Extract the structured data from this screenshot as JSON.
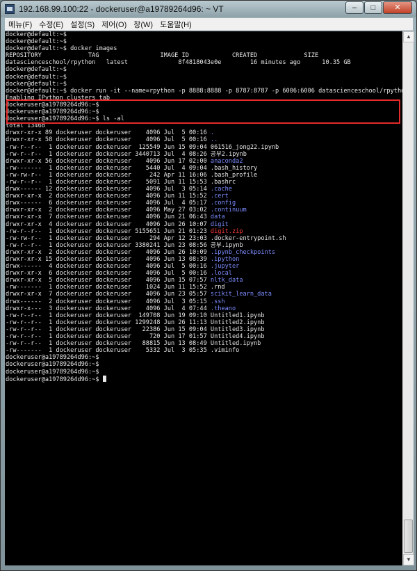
{
  "window": {
    "title": "192.168.99.100:22 - dockeruser@a19789264d96: ~ VT",
    "buttons": {
      "minimize": "–",
      "maximize": "□",
      "close": "✕"
    }
  },
  "menubar": {
    "items": [
      "메뉴(F)",
      "수정(E)",
      "설정(S)",
      "제어(O)",
      "창(W)",
      "도움말(H)"
    ]
  },
  "colors": {
    "terminal_bg": "#000000",
    "text": "#e8e8e8",
    "dir": "#7c8cff",
    "archive": "#ff3a3a",
    "highlight": "#e42a2a"
  },
  "terminal": {
    "lines": [
      [
        {
          "t": "docker@default:~$"
        }
      ],
      [
        {
          "t": "docker@default:~$"
        }
      ],
      [
        {
          "t": "docker@default:~$ docker images"
        }
      ],
      [
        {
          "t": "REPOSITORY             TAG                 IMAGE ID            CREATED             SIZE"
        }
      ],
      [
        {
          "t": "datascienceschool/rpython   latest              8f4818043e0e        16 minutes ago      10.35 GB"
        }
      ],
      [
        {
          "t": "docker@default:~$"
        }
      ],
      [
        {
          "t": "docker@default:~$"
        }
      ],
      [
        {
          "t": "docker@default:~$"
        }
      ],
      [
        {
          "t": "docker@default:~$ docker run -it --name=rpython -p 8888:8888 -p 8787:8787 -p 6006:6006 datascienceschool/rpython"
        }
      ],
      [
        {
          "t": "Enabling IPython clusters tab"
        }
      ],
      [
        {
          "t": "dockeruser@a19789264d96:~$"
        }
      ],
      [
        {
          "t": "dockeruser@a19789264d96:~$"
        }
      ],
      [
        {
          "t": "dockeruser@a19789264d96:~$ ls -al"
        }
      ],
      [
        {
          "t": "total 13468"
        }
      ],
      [
        {
          "t": "drwxr-xr-x 89 dockeruser dockeruser    4096 Jul  5 00:16 "
        },
        {
          "t": ".",
          "c": "dir"
        }
      ],
      [
        {
          "t": "drwxr-xr-x 58 dockeruser dockeruser    4096 Jul  5 00:16 "
        },
        {
          "t": "..",
          "c": "dir"
        }
      ],
      [
        {
          "t": "-rw-r--r--  1 dockeruser dockeruser  125549 Jun 15 09:04 061516_jong22.ipynb"
        }
      ],
      [
        {
          "t": "-rw-r--r--  1 dockeruser dockeruser 3440713 Jul  4 08:26 공부2.ipynb"
        }
      ],
      [
        {
          "t": "drwxr-xr-x 56 dockeruser dockeruser    4096 Jun 17 02:00 "
        },
        {
          "t": "anaconda2",
          "c": "dir"
        }
      ],
      [
        {
          "t": "-rw-------  1 dockeruser dockeruser    5440 Jul  4 09:04 .bash_history"
        }
      ],
      [
        {
          "t": "-rw-rw-r--  1 dockeruser dockeruser     242 Apr 11 16:06 .bash_profile"
        }
      ],
      [
        {
          "t": "-rw-r--r--  1 dockeruser dockeruser    5091 Jun 11 15:53 .bashrc"
        }
      ],
      [
        {
          "t": "drwx------ 12 dockeruser dockeruser    4096 Jul  3 05:14 "
        },
        {
          "t": ".cache",
          "c": "dir"
        }
      ],
      [
        {
          "t": "drwxr-xr-x  2 dockeruser dockeruser    4096 Jun 11 15:52 "
        },
        {
          "t": ".cert",
          "c": "dir"
        }
      ],
      [
        {
          "t": "drwx------  6 dockeruser dockeruser    4096 Jul  4 05:17 "
        },
        {
          "t": ".config",
          "c": "dir"
        }
      ],
      [
        {
          "t": "drwxr-xr-x  2 dockeruser dockeruser    4096 May 27 03:02 "
        },
        {
          "t": ".continuum",
          "c": "dir"
        }
      ],
      [
        {
          "t": "drwxr-xr-x  7 dockeruser dockeruser    4096 Jun 21 06:43 "
        },
        {
          "t": "data",
          "c": "dir"
        }
      ],
      [
        {
          "t": "drwxr-xr-x  4 dockeruser dockeruser    4096 Jun 26 10:07 "
        },
        {
          "t": "digit",
          "c": "dir"
        }
      ],
      [
        {
          "t": "-rw-r--r--  1 dockeruser dockeruser 5155651 Jun 21 01:23 "
        },
        {
          "t": "digit.zip",
          "c": "archive"
        }
      ],
      [
        {
          "t": "-rw-rw-r--  1 dockeruser dockeruser     294 Apr 12 23:03 .docker-entrypoint.sh"
        }
      ],
      [
        {
          "t": "-rw-r--r--  1 dockeruser dockeruser 3380241 Jun 23 08:56 공부.ipynb"
        }
      ],
      [
        {
          "t": "drwxr-xr-x  2 dockeruser dockeruser    4096 Jun 26 10:09 "
        },
        {
          "t": ".ipynb_checkpoints",
          "c": "dir"
        }
      ],
      [
        {
          "t": "drwxr-xr-x 15 dockeruser dockeruser    4096 Jun 13 08:39 "
        },
        {
          "t": ".ipython",
          "c": "dir"
        }
      ],
      [
        {
          "t": "drwx------  4 dockeruser dockeruser    4096 Jul  5 00:16 "
        },
        {
          "t": ".jupyter",
          "c": "dir"
        }
      ],
      [
        {
          "t": "drwxr-xr-x  6 dockeruser dockeruser    4096 Jul  5 00:16 "
        },
        {
          "t": ".local",
          "c": "dir"
        }
      ],
      [
        {
          "t": "drwxr-xr-x  5 dockeruser dockeruser    4096 Jun 15 07:57 "
        },
        {
          "t": "nltk_data",
          "c": "dir"
        }
      ],
      [
        {
          "t": "-rw-------  1 dockeruser dockeruser    1024 Jun 11 15:52 .rnd"
        }
      ],
      [
        {
          "t": "drwxr-xr-x  7 dockeruser dockeruser    4096 Jun 23 05:57 "
        },
        {
          "t": "scikit_learn_data",
          "c": "dir"
        }
      ],
      [
        {
          "t": "drwx------  2 dockeruser dockeruser    4096 Jul  3 05:15 "
        },
        {
          "t": ".ssh",
          "c": "dir"
        }
      ],
      [
        {
          "t": "drwxr-x---  3 dockeruser dockeruser    4096 Jul  4 07:44 "
        },
        {
          "t": ".theano",
          "c": "dir"
        }
      ],
      [
        {
          "t": "-rw-r--r--  1 dockeruser dockeruser  149708 Jun 19 09:10 Untitled1.ipynb"
        }
      ],
      [
        {
          "t": "-rw-r--r--  1 dockeruser dockeruser 1299248 Jun 26 11:13 Untitled2.ipynb"
        }
      ],
      [
        {
          "t": "-rw-r--r--  1 dockeruser dockeruser   22386 Jun 15 09:04 Untitled3.ipynb"
        }
      ],
      [
        {
          "t": "-rw-r--r--  1 dockeruser dockeruser     720 Jun 17 01:57 Untitled4.ipynb"
        }
      ],
      [
        {
          "t": "-rw-r--r--  1 dockeruser dockeruser   88815 Jun 13 08:49 Untitled.ipynb"
        }
      ],
      [
        {
          "t": "-rw-------  1 dockeruser dockeruser    5332 Jul  3 05:35 .viminfo"
        }
      ],
      [
        {
          "t": "dockeruser@a19789264d96:~$"
        }
      ],
      [
        {
          "t": "dockeruser@a19789264d96:~$"
        }
      ],
      [
        {
          "t": "dockeruser@a19789264d96:~$"
        }
      ],
      [
        {
          "t": "dockeruser@a19789264d96:~$ ",
          "cursor": true
        }
      ]
    ]
  }
}
